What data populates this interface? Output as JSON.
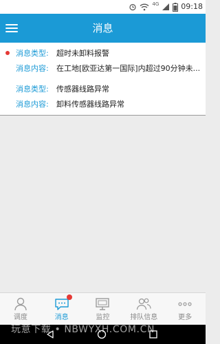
{
  "status_bar": {
    "network": "4G",
    "time": "09:18"
  },
  "header": {
    "title": "消息"
  },
  "messages": [
    {
      "unread": true,
      "type_label": "消息类型:",
      "type_value": "超时未卸料报警",
      "content_label": "消息内容:",
      "content_value": "在工地[欧亚达第一国际]内超过90分钟未..."
    },
    {
      "unread": false,
      "type_label": "消息类型:",
      "type_value": "传感器线路异常",
      "content_label": "消息内容:",
      "content_value": "卸料传感器线路异常"
    }
  ],
  "bottom_nav": [
    {
      "label": "调度",
      "icon": "person-icon",
      "active": false,
      "badge": false
    },
    {
      "label": "消息",
      "icon": "chat-bubble-icon",
      "active": true,
      "badge": true
    },
    {
      "label": "监控",
      "icon": "monitor-icon",
      "active": false,
      "badge": false
    },
    {
      "label": "排队信息",
      "icon": "group-icon",
      "active": false,
      "badge": false
    },
    {
      "label": "更多",
      "icon": "more-dots-icon",
      "active": false,
      "badge": false
    }
  ],
  "watermark": "玩意下载 • NBWYXH.COM.CN",
  "colors": {
    "primary": "#1b9ad6",
    "badge": "#e53935"
  }
}
